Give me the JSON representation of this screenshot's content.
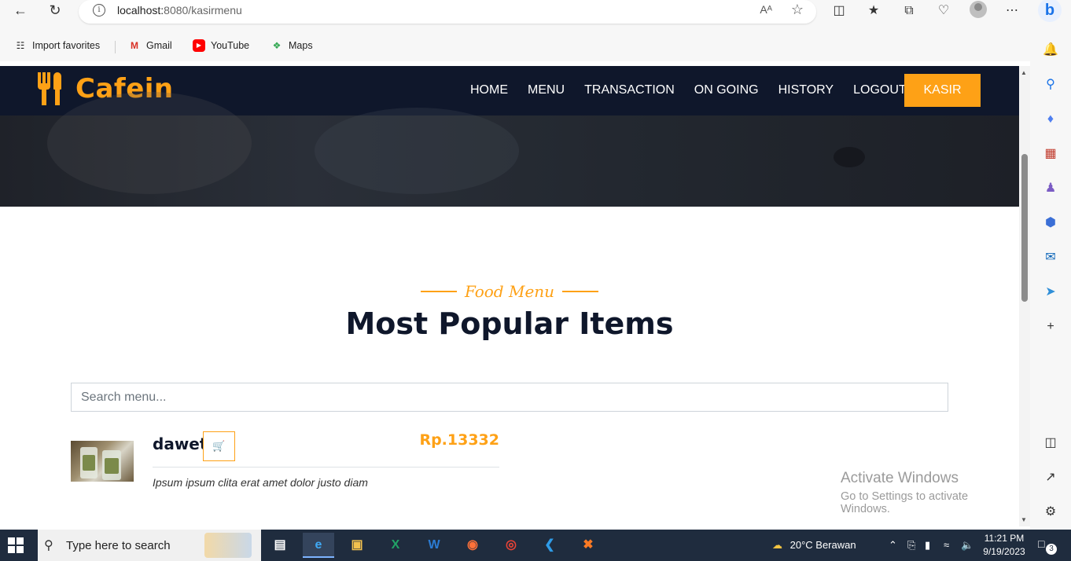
{
  "browser": {
    "url_host": "localhost:",
    "url_rest": "8080/kasirmenu",
    "read_aloud": "Aᴬ",
    "favorites": [
      {
        "label": "Import favorites",
        "icon": "import-icon"
      },
      {
        "label": "Gmail",
        "icon": "gmail-icon"
      },
      {
        "label": "YouTube",
        "icon": "youtube-icon"
      },
      {
        "label": "Maps",
        "icon": "maps-icon"
      }
    ]
  },
  "site": {
    "brand": "Cafein",
    "nav": [
      "HOME",
      "MENU",
      "TRANSACTION",
      "ON GOING",
      "HISTORY",
      "LOGOUT"
    ],
    "kasir_label": "KASIR",
    "section_sub": "Food Menu",
    "section_title": "Most Popular Items",
    "search_placeholder": "Search menu...",
    "items": [
      {
        "name": "dawet",
        "price": "Rp.13332",
        "desc": "Ipsum ipsum clita erat amet dolor justo diam"
      }
    ]
  },
  "watermark": {
    "line1": "Activate Windows",
    "line2": "Go to Settings to activate Windows."
  },
  "taskbar": {
    "search_placeholder": "Type here to search",
    "weather": "20°C  Berawan",
    "time": "11:21 PM",
    "date": "9/19/2023",
    "notifications": "3"
  },
  "colors": {
    "accent": "#fea116",
    "navy": "#0f172b",
    "taskbar": "#1f2c3e"
  }
}
